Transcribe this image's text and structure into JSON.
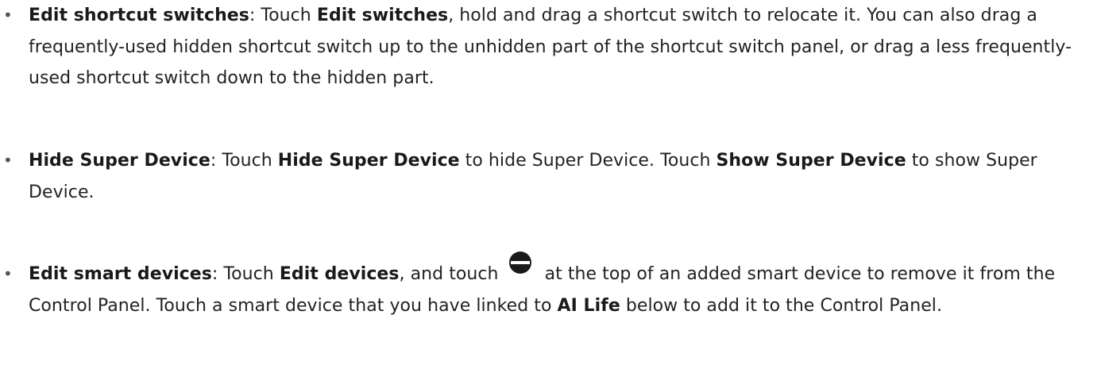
{
  "colors": {
    "text": "#222222",
    "icon": "#1a1a1a"
  },
  "items": [
    {
      "bullet": "•",
      "title": "Edit shortcut switches",
      "parts": [
        ": Touch ",
        "Edit switches",
        ", hold and drag a shortcut switch to relocate it. You can also drag a frequently-used hidden shortcut switch up to the unhidden part of the shortcut switch panel, or drag a less frequently-used shortcut switch down to the hidden part."
      ]
    },
    {
      "bullet": "•",
      "title": "Hide Super Device",
      "parts": [
        ": Touch ",
        "Hide Super Device",
        " to hide Super Device. Touch ",
        "Show Super Device",
        " to show Super Device."
      ]
    },
    {
      "bullet": "•",
      "title": "Edit smart devices",
      "icon": "remove-circle-icon",
      "parts": [
        ": Touch ",
        "Edit devices",
        ", and touch ",
        " at the top of an added smart device to remove it from the Control Panel. Touch a smart device that you have linked to ",
        "AI Life",
        " below to add it to the Control Panel."
      ]
    }
  ]
}
